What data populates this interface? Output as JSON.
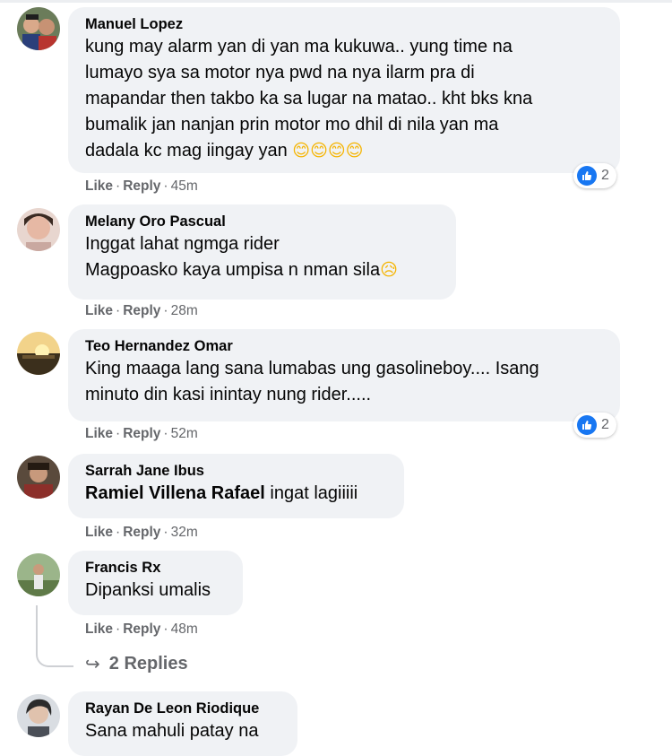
{
  "comments": [
    {
      "author": "Manuel Lopez",
      "text": "kung may alarm yan di yan ma kukuwa.. yung time na\nlumayo sya sa motor nya pwd na nya ilarm pra di\nmapandar then takbo ka sa lugar na matao.. kht bks kna\nbumalik jan nanjan prin motor mo dhil di nila yan ma\ndadala kc mag iingay yan",
      "emoji": "😊😊😊😊",
      "like": "Like",
      "reply": "Reply",
      "time": "45m",
      "reaction_count": "2"
    },
    {
      "author": "Melany Oro Pascual",
      "text": "Inggat lahat ngmga rider\nMagpoasko kaya umpisa n nman sila",
      "emoji": "😥",
      "like": "Like",
      "reply": "Reply",
      "time": "28m"
    },
    {
      "author": "Teo Hernandez Omar",
      "text": "King maaga lang sana lumabas ung gasolineboy.... Isang\nminuto din kasi inintay nung rider.....",
      "like": "Like",
      "reply": "Reply",
      "time": "52m",
      "reaction_count": "2"
    },
    {
      "author": "Sarrah Jane Ibus",
      "mention": "Ramiel Villena Rafael",
      "text": " ingat lagiiiii",
      "like": "Like",
      "reply": "Reply",
      "time": "32m"
    },
    {
      "author": "Francis Rx",
      "text": "Dipanksi umalis",
      "like": "Like",
      "reply": "Reply",
      "time": "48m"
    },
    {
      "author": "Rayan De Leon Riodique",
      "text": "Sana mahuli patay na"
    }
  ],
  "replies_link": "2 Replies",
  "colors": {
    "like_blue": "#1877f2",
    "bubble": "#f0f2f5",
    "meta": "#65676b"
  },
  "icons": [
    "like-icon",
    "reply-arrow-icon",
    "avatar"
  ]
}
